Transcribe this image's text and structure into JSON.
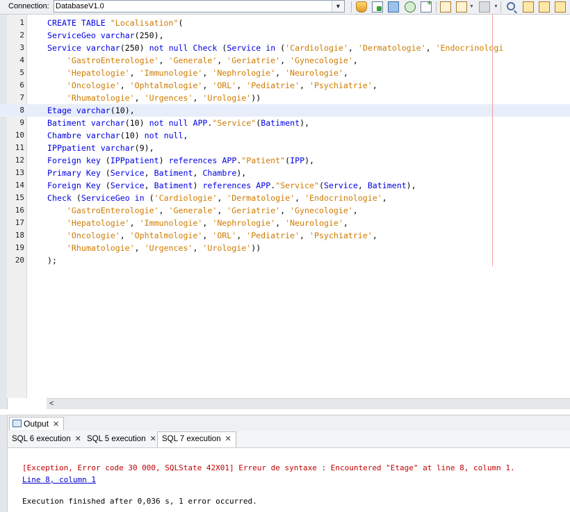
{
  "toolbar": {
    "connection_label": "Connection:",
    "connection_value": "DatabaseV1.0",
    "icons": [
      "run-sql-icon",
      "run-file-icon",
      "history-net-icon",
      "refresh-icon",
      "new-tab-icon",
      "keep-prior-tabs-icon",
      "history-icon",
      "format-icon",
      "find-icon",
      "find-previous-icon",
      "find-next-icon",
      "find-selection-icon"
    ]
  },
  "editor": {
    "lines": [
      {
        "num": "1",
        "text": "CREATE TABLE \"Localisation\"("
      },
      {
        "num": "2",
        "text": "ServiceGeo varchar(250),"
      },
      {
        "num": "3",
        "text": "Service varchar(250) not null Check (Service in ('Cardiologie', 'Dermatologie', 'Endocrinologi"
      },
      {
        "num": "4",
        "text": "    'GastroEnterologie', 'Generale', 'Geriatrie', 'Gynecologie',"
      },
      {
        "num": "5",
        "text": "    'Hepatologie', 'Immunologie', 'Nephrologie', 'Neurologie',"
      },
      {
        "num": "6",
        "text": "    'Oncologie', 'Ophtalmologie', 'ORL', 'Pediatrie', 'Psychiatrie',"
      },
      {
        "num": "7",
        "text": "    'Rhumatologie', 'Urgences', 'Urologie'))"
      },
      {
        "num": "8",
        "text": "Etage varchar(10),"
      },
      {
        "num": "9",
        "text": "Batiment varchar(10) not null APP.\"Service\"(Batiment),"
      },
      {
        "num": "10",
        "text": "Chambre varchar(10) not null,"
      },
      {
        "num": "11",
        "text": "IPPpatient varchar(9),"
      },
      {
        "num": "12",
        "text": "Foreign key (IPPpatient) references APP.\"Patient\"(IPP),"
      },
      {
        "num": "13",
        "text": "Primary Key (Service, Batiment, Chambre),"
      },
      {
        "num": "14",
        "text": "Foreign Key (Service, Batiment) references APP.\"Service\"(Service, Batiment),"
      },
      {
        "num": "15",
        "text": "Check (ServiceGeo in ('Cardiologie', 'Dermatologie', 'Endocrinologie',"
      },
      {
        "num": "16",
        "text": "    'GastroEnterologie', 'Generale', 'Geriatrie', 'Gynecologie',"
      },
      {
        "num": "17",
        "text": "    'Hepatologie', 'Immunologie', 'Nephrologie', 'Neurologie',"
      },
      {
        "num": "18",
        "text": "    'Oncologie', 'Ophtalmologie', 'ORL', 'Pediatrie', 'Psychiatrie',"
      },
      {
        "num": "19",
        "text": "    'Rhumatologie', 'Urgences', 'Urologie'))"
      },
      {
        "num": "20",
        "text": ");"
      }
    ],
    "current_line": 8,
    "scroll_left_glyph": "<"
  },
  "output": {
    "tab_label": "Output",
    "close_glyph": "✕",
    "sql_tabs": [
      "SQL 6 execution",
      "SQL 5 execution",
      "SQL 7 execution"
    ],
    "active_sql_tab": 2,
    "error_text": "[Exception, Error code 30 000, SQLState 42X01] Erreur de syntaxe : Encountered \"Etage\" at line 8, column 1.",
    "error_link": "Line 8, column 1",
    "status_text": "Execution finished after 0,036 s, 1 error occurred."
  },
  "colors": {
    "keyword": "#0000e6",
    "string": "#ce7b00",
    "error": "#c00000",
    "link": "#0000cc",
    "current_line_bg": "#e8eef9",
    "margin_line": "#f2a3a3"
  }
}
